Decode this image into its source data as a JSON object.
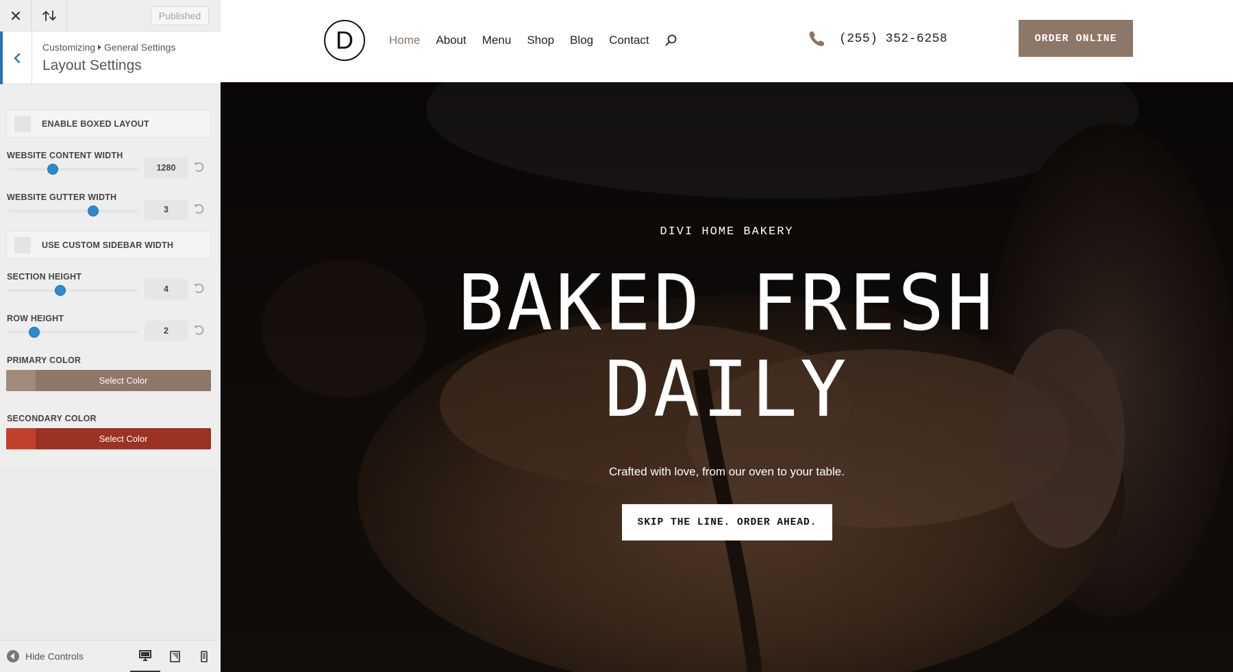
{
  "customizer": {
    "topbar": {
      "published_label": "Published"
    },
    "breadcrumb": {
      "root": "Customizing",
      "section": "General Settings"
    },
    "panel_title": "Layout Settings",
    "controls": {
      "boxed_layout": {
        "label": "ENABLE BOXED LAYOUT",
        "enabled": false
      },
      "content_width": {
        "label": "WEBSITE CONTENT WIDTH",
        "value": "1280",
        "slider_fraction": 0.34
      },
      "gutter_width": {
        "label": "WEBSITE GUTTER WIDTH",
        "value": "3",
        "slider_fraction": 0.65
      },
      "custom_sidebar": {
        "label": "USE CUSTOM SIDEBAR WIDTH",
        "enabled": false
      },
      "section_height": {
        "label": "SECTION HEIGHT",
        "value": "4",
        "slider_fraction": 0.4
      },
      "row_height": {
        "label": "ROW HEIGHT",
        "value": "2",
        "slider_fraction": 0.2
      },
      "primary_color": {
        "label": "PRIMARY COLOR",
        "button_label": "Select Color",
        "color": "#8d7767",
        "swatch": "#a08a79"
      },
      "secondary_color": {
        "label": "SECONDARY COLOR",
        "button_label": "Select Color",
        "color": "#9b3223",
        "swatch": "#c1412e"
      }
    },
    "footer": {
      "hide_controls_label": "Hide Controls",
      "devices": [
        "desktop-icon",
        "tablet-icon",
        "mobile-icon"
      ],
      "active_device": "desktop"
    },
    "icons": {
      "close": "close-icon",
      "reorder": "arrows-updown-icon",
      "back": "chevron-left-icon",
      "reset": "undo-icon"
    },
    "accent": "#2a72b4"
  },
  "site": {
    "logo_letter": "D",
    "nav": [
      {
        "label": "Home",
        "active": true
      },
      {
        "label": "About"
      },
      {
        "label": "Menu"
      },
      {
        "label": "Shop"
      },
      {
        "label": "Blog"
      },
      {
        "label": "Contact"
      }
    ],
    "phone": "(255) 352-6258",
    "order_button": "ORDER ONLINE",
    "hero": {
      "kicker": "DIVI HOME BAKERY",
      "title_line1": "BAKED FRESH",
      "title_line2": "DAILY",
      "subtitle": "Crafted with love, from our oven to your table.",
      "cta": "SKIP THE LINE. ORDER AHEAD."
    },
    "colors": {
      "brand": "#8d7767",
      "nav_active": "#8b7768"
    }
  }
}
